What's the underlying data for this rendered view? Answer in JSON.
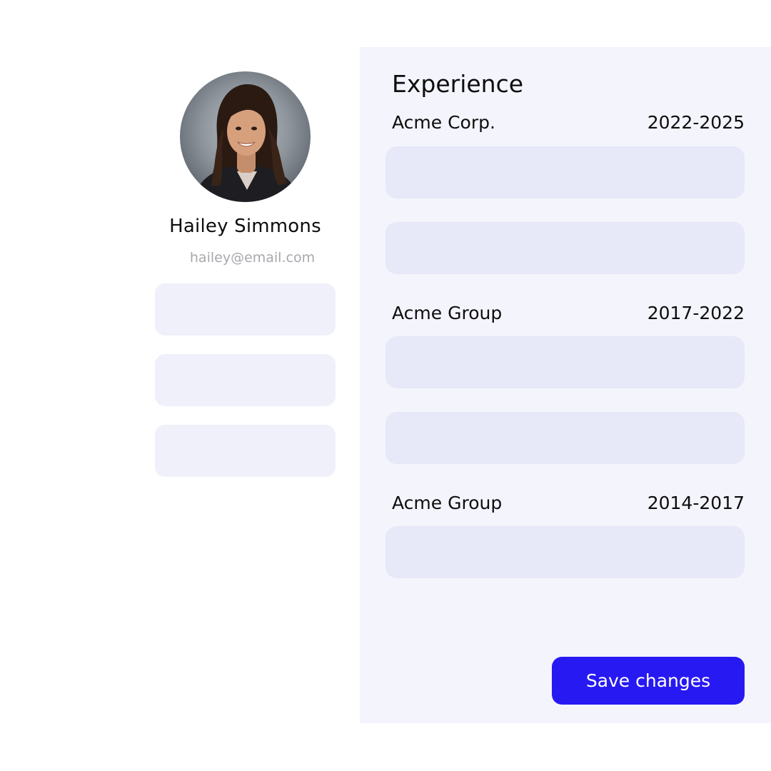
{
  "profile": {
    "name": "Hailey Simmons",
    "email": "hailey@email.com",
    "fields": [
      {
        "value": ""
      },
      {
        "value": ""
      },
      {
        "value": ""
      }
    ]
  },
  "experience": {
    "title": "Experience",
    "jobs": [
      {
        "company": "Acme Corp.",
        "years": "2022-2025",
        "fields": [
          {
            "value": ""
          },
          {
            "value": ""
          }
        ]
      },
      {
        "company": "Acme Group",
        "years": "2017-2022",
        "fields": [
          {
            "value": ""
          },
          {
            "value": ""
          }
        ]
      },
      {
        "company": "Acme Group",
        "years": "2014-2017",
        "fields": [
          {
            "value": ""
          }
        ]
      }
    ]
  },
  "actions": {
    "save_label": "Save changes"
  },
  "colors": {
    "accent": "#2719f2",
    "panel_background": "#f4f4fd",
    "field_background": "#e7e8f8",
    "profile_field_background": "#f0f0fa",
    "muted_text": "#a8a8ad"
  }
}
